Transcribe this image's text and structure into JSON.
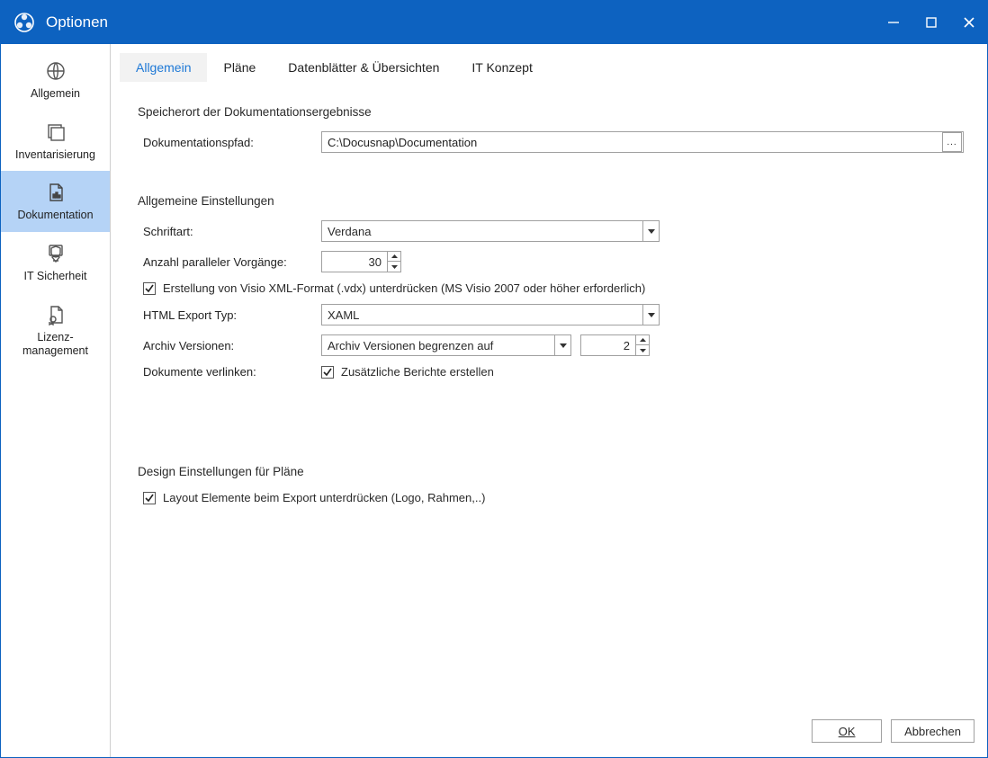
{
  "window": {
    "title": "Optionen"
  },
  "sidebar": {
    "items": [
      {
        "id": "allgemein",
        "label": "Allgemein"
      },
      {
        "id": "inventarisierung",
        "label": "Inventarisierung"
      },
      {
        "id": "dokumentation",
        "label": "Dokumentation"
      },
      {
        "id": "it-sicherheit",
        "label": "IT Sicherheit"
      },
      {
        "id": "lizenz-management",
        "label": "Lizenz-\nmanagement"
      }
    ],
    "selected": "dokumentation"
  },
  "tabs": {
    "items": [
      {
        "id": "allgemein",
        "label": "Allgemein"
      },
      {
        "id": "plaene",
        "label": "Pläne"
      },
      {
        "id": "datenblaetter",
        "label": "Datenblätter & Übersichten"
      },
      {
        "id": "itkonzept",
        "label": "IT Konzept"
      }
    ],
    "active": "allgemein"
  },
  "sections": {
    "storage": {
      "heading": "Speicherort der Dokumentationsergebnisse",
      "path_label": "Dokumentationspfad:",
      "path_value": "C:\\Docusnap\\Documentation",
      "browse_caption": "..."
    },
    "general": {
      "heading": "Allgemeine Einstellungen",
      "font_label": "Schriftart:",
      "font_value": "Verdana",
      "parallel_label": "Anzahl paralleler Vorgänge:",
      "parallel_value": "30",
      "suppress_vdx_label": "Erstellung von Visio XML-Format (.vdx) unterdrücken (MS Visio 2007 oder höher erforderlich)",
      "suppress_vdx_checked": true,
      "html_export_label": "HTML Export Typ:",
      "html_export_value": "XAML",
      "archive_label": "Archiv Versionen:",
      "archive_mode": "Archiv Versionen begrenzen auf",
      "archive_value": "2",
      "link_docs_label": "Dokumente verlinken:",
      "extra_reports_label": "Zusätzliche Berichte erstellen",
      "extra_reports_checked": true
    },
    "design": {
      "heading": "Design Einstellungen für Pläne",
      "suppress_layout_label": "Layout Elemente beim Export unterdrücken (Logo, Rahmen,..)",
      "suppress_layout_checked": true
    }
  },
  "footer": {
    "ok": "OK",
    "cancel": "Abbrechen"
  }
}
